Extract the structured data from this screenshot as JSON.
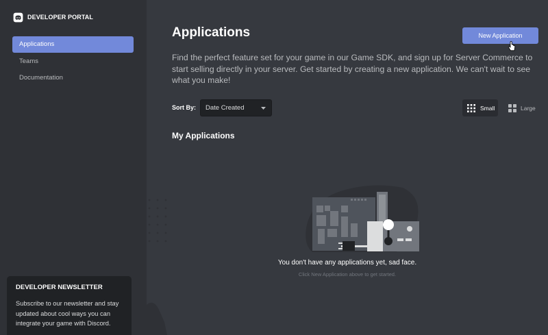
{
  "brand": {
    "name": "DEVELOPER PORTAL",
    "logo_icon": "discord-logo-icon"
  },
  "sidebar": {
    "items": [
      {
        "label": "Applications",
        "active": true
      },
      {
        "label": "Teams",
        "active": false
      },
      {
        "label": "Documentation",
        "active": false
      }
    ],
    "newsletter": {
      "title": "DEVELOPER NEWSLETTER",
      "text": "Subscribe to our newsletter and stay updated about cool ways you can integrate your game with Discord."
    }
  },
  "main": {
    "title": "Applications",
    "new_app_label": "New Application",
    "intro": "Find the perfect feature set for your game in our Game SDK, and sign up for Server Commerce to start selling directly in your server. Get started by creating a new application. We can't wait to see what you make!",
    "sort": {
      "label": "Sort By:",
      "value": "Date Created"
    },
    "view": {
      "small_label": "Small",
      "large_label": "Large",
      "selected": "Small"
    },
    "section_title": "My Applications",
    "empty": {
      "title": "You don't have any applications yet, sad face.",
      "subtitle": "Click New Application above to get started."
    }
  },
  "colors": {
    "accent": "#7289da",
    "background": "#36393f",
    "sidebar": "#2f3136",
    "dark": "#202225"
  }
}
